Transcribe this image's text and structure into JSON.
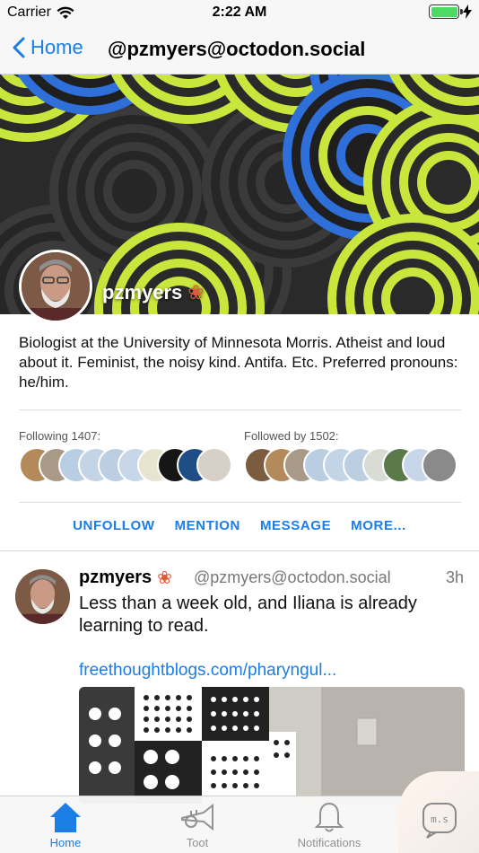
{
  "status": {
    "carrier": "Carrier",
    "time": "2:22 AM",
    "battery_level": 1.0
  },
  "nav": {
    "back_label": "Home",
    "title": "@pzmyers@octodon.social"
  },
  "profile": {
    "display_name": "pzmyers",
    "bio": "Biologist at the University of Minnesota Morris. Atheist and loud about it. Feminist, the noisy kind. Antifa. Etc. Preferred pronouns: he/him.",
    "following_label": "Following 1407:",
    "followers_label": "Followed by 1502:"
  },
  "actions": {
    "unfollow": "UNFOLLOW",
    "mention": "MENTION",
    "message": "MESSAGE",
    "more": "MORE..."
  },
  "toot": {
    "name": "pzmyers",
    "handle": "@pzmyers@octodon.social",
    "time": "3h",
    "text": "Less than a week old, and Iliana is already learning to read.",
    "link": "freethoughtblogs.com/pharyngul..."
  },
  "tabs": [
    {
      "label": "Home",
      "icon": "home-icon",
      "active": true
    },
    {
      "label": "Toot",
      "icon": "trumpet-icon",
      "active": false
    },
    {
      "label": "Notifications",
      "icon": "bell-icon",
      "active": false
    }
  ],
  "colors": {
    "accent": "#1a7ee6",
    "banner_lime": "#c8e63c",
    "banner_blue": "#2f6fd9"
  }
}
